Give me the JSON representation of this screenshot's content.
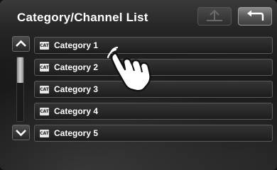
{
  "header": {
    "title": "Category/Channel List"
  },
  "buttons": {
    "top_icon": "up-to-top-arrow-icon",
    "back_icon": "return-arrow-icon"
  },
  "list": {
    "items": [
      {
        "badge": "CAT",
        "label": "Category 1"
      },
      {
        "badge": "CAT",
        "label": "Category 2"
      },
      {
        "badge": "CAT",
        "label": "Category 3"
      },
      {
        "badge": "CAT",
        "label": "Category 4"
      },
      {
        "badge": "CAT",
        "label": "Category 5"
      }
    ]
  },
  "scroll": {
    "up_icon": "chevron-up-icon",
    "down_icon": "chevron-down-icon"
  },
  "colors": {
    "text": "#ffffff",
    "row_border": "#5a5a5a",
    "background": "#151515"
  }
}
